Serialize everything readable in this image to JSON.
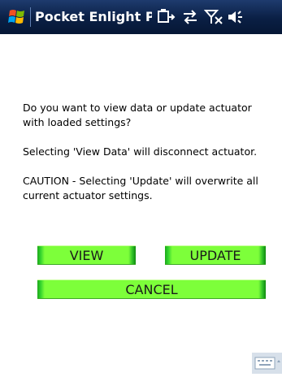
{
  "titlebar": {
    "app_title": "Pocket Enlight Pro",
    "icons": [
      "windows-start-icon",
      "battery-icon",
      "sync-arrows-icon",
      "no-signal-icon",
      "speaker-icon"
    ]
  },
  "dialog": {
    "message_1": "Do you want to view data or update actuator with loaded settings?",
    "message_2": "Selecting 'View Data' will disconnect actuator.",
    "message_3": "CAUTION - Selecting 'Update' will overwrite all current actuator settings."
  },
  "buttons": {
    "view": "VIEW",
    "update": "UPDATE",
    "cancel": "CANCEL"
  },
  "softbar": {
    "icon": "keyboard-icon"
  },
  "colors": {
    "titlebar_dark": "#0a1f44",
    "button_green": "#7dff3a",
    "button_edge": "#1ea81a"
  }
}
